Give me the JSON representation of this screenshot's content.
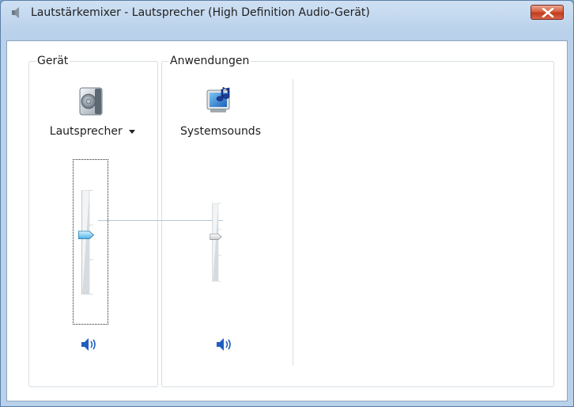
{
  "window": {
    "title": "Lautstärkemixer - Lautsprecher (High Definition Audio-Gerät)"
  },
  "device": {
    "group_label": "Gerät",
    "name": "Lautsprecher",
    "icon": "speaker-icon",
    "volume_percent": 57,
    "mute_icon": "speaker-volume-icon"
  },
  "applications": {
    "group_label": "Anwendungen",
    "items": [
      {
        "name": "Systemsounds",
        "icon": "system-sounds-icon",
        "volume_percent": 57,
        "mute_icon": "speaker-volume-icon"
      }
    ]
  },
  "colors": {
    "titlebar": "#b9d1ea",
    "close_button": "#c13b1d",
    "thumb_active": "#4ab1e8",
    "mute_icon": "#1f5fbf"
  }
}
